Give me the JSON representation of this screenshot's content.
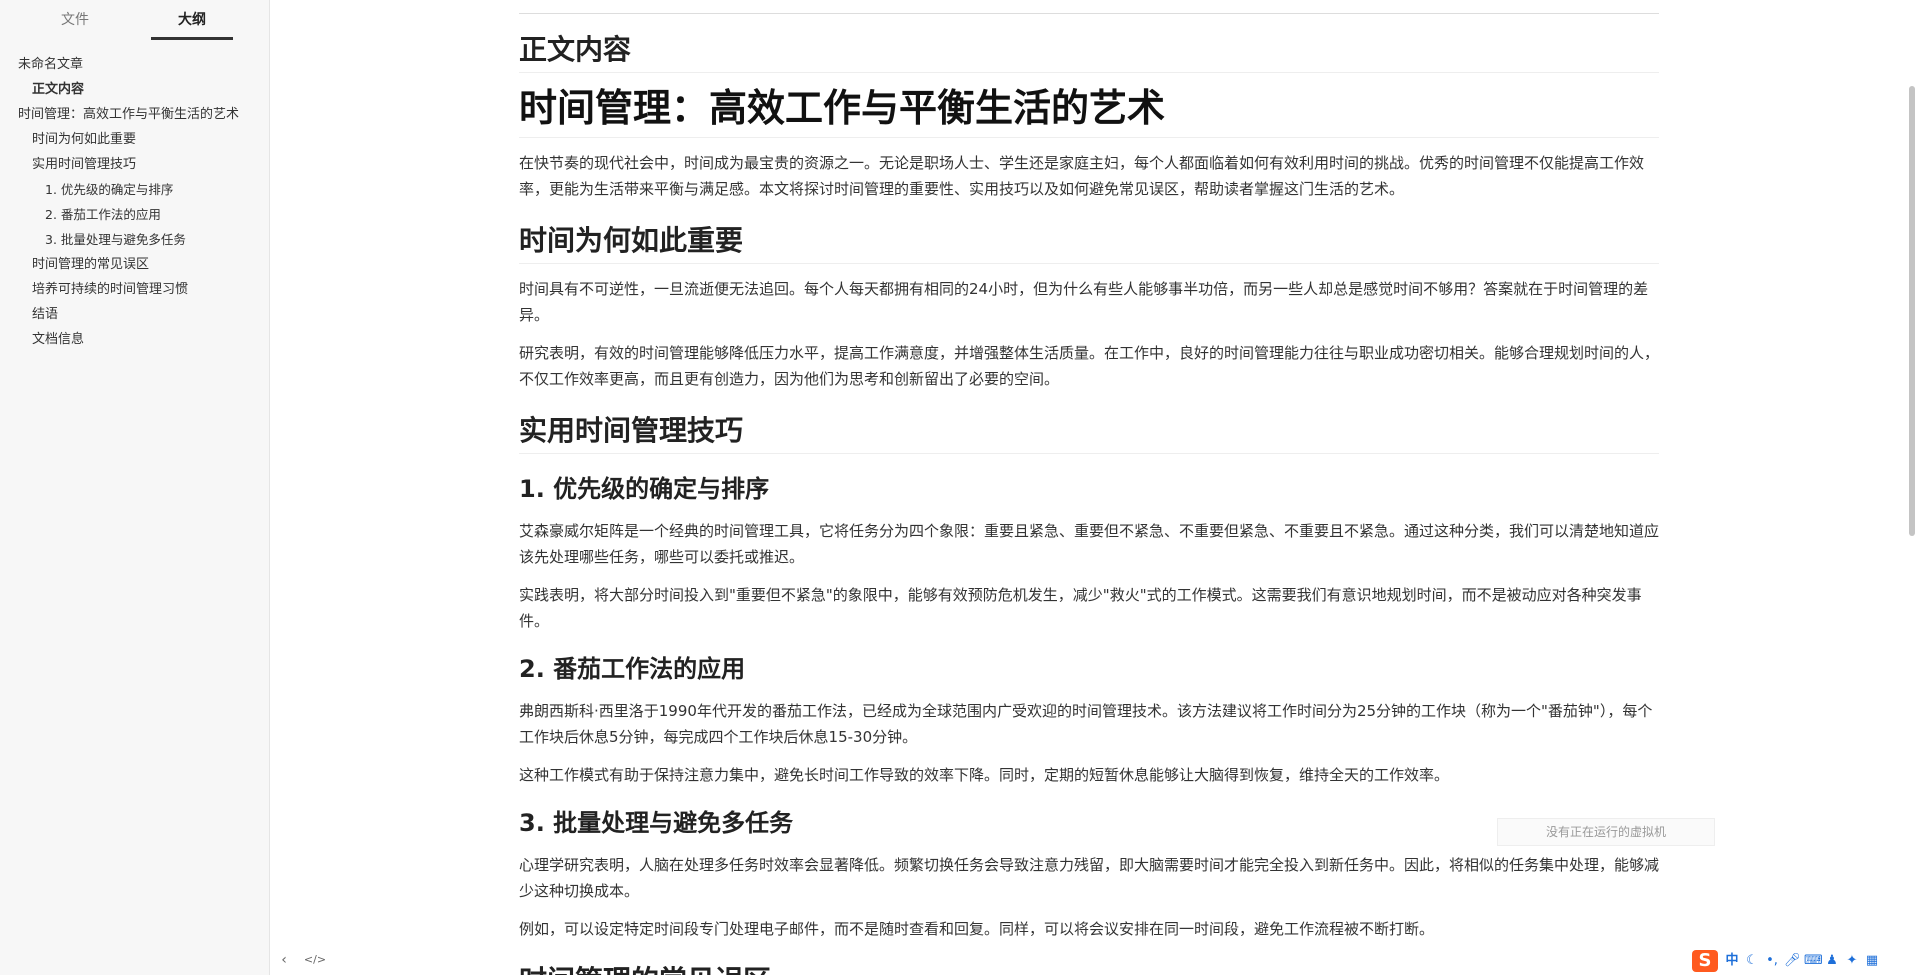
{
  "sidebar": {
    "tabs": [
      {
        "label": "文件"
      },
      {
        "label": "大纲"
      }
    ],
    "outline": [
      {
        "label": "未命名文章"
      },
      {
        "label": "正文内容"
      },
      {
        "label": "时间管理：高效工作与平衡生活的艺术"
      },
      {
        "label": "时间为何如此重要"
      },
      {
        "label": "实用时间管理技巧"
      },
      {
        "label": "1. 优先级的确定与排序"
      },
      {
        "label": "2. 番茄工作法的应用"
      },
      {
        "label": "3. 批量处理与避免多任务"
      },
      {
        "label": "时间管理的常见误区"
      },
      {
        "label": "培养可持续的时间管理习惯"
      },
      {
        "label": "结语"
      },
      {
        "label": "文档信息"
      }
    ],
    "footer": {
      "collapse_glyph": "‹",
      "source_glyph": "</>"
    }
  },
  "article": {
    "section_heading": "正文内容",
    "title": "时间管理：高效工作与平衡生活的艺术",
    "intro": "在快节奏的现代社会中，时间成为最宝贵的资源之一。无论是职场人士、学生还是家庭主妇，每个人都面临着如何有效利用时间的挑战。优秀的时间管理不仅能提高工作效率，更能为生活带来平衡与满足感。本文将探讨时间管理的重要性、实用技巧以及如何避免常见误区，帮助读者掌握这门生活的艺术。",
    "h2_why": "时间为何如此重要",
    "why_p1": "时间具有不可逆性，一旦流逝便无法追回。每个人每天都拥有相同的24小时，但为什么有些人能够事半功倍，而另一些人却总是感觉时间不够用？答案就在于时间管理的差异。",
    "why_p2": "研究表明，有效的时间管理能够降低压力水平，提高工作满意度，并增强整体生活质量。在工作中，良好的时间管理能力往往与职业成功密切相关。能够合理规划时间的人，不仅工作效率更高，而且更有创造力，因为他们为思考和创新留出了必要的空间。",
    "h2_tips": "实用时间管理技巧",
    "h3_priority": "1. 优先级的确定与排序",
    "priority_p1": "艾森豪威尔矩阵是一个经典的时间管理工具，它将任务分为四个象限：重要且紧急、重要但不紧急、不重要但紧急、不重要且不紧急。通过这种分类，我们可以清楚地知道应该先处理哪些任务，哪些可以委托或推迟。",
    "priority_p2": "实践表明，将大部分时间投入到\"重要但不紧急\"的象限中，能够有效预防危机发生，减少\"救火\"式的工作模式。这需要我们有意识地规划时间，而不是被动应对各种突发事件。",
    "h3_pomodoro": "2. 番茄工作法的应用",
    "pomodoro_p1": "弗朗西斯科·西里洛于1990年代开发的番茄工作法，已经成为全球范围内广受欢迎的时间管理技术。该方法建议将工作时间分为25分钟的工作块（称为一个\"番茄钟\"），每个工作块后休息5分钟，每完成四个工作块后休息15-30分钟。",
    "pomodoro_p2": "这种工作模式有助于保持注意力集中，避免长时间工作导致的效率下降。同时，定期的短暂休息能够让大脑得到恢复，维持全天的工作效率。",
    "h3_batch": "3. 批量处理与避免多任务",
    "batch_p1": "心理学研究表明，人脑在处理多任务时效率会显著降低。频繁切换任务会导致注意力残留，即大脑需要时间才能完全投入到新任务中。因此，将相似的任务集中处理，能够减少这种切换成本。",
    "batch_p2": "例如，可以设定特定时间段专门处理电子邮件，而不是随时查看和回复。同样，可以将会议安排在同一时间段，避免工作流程被不断打断。",
    "h2_pitfalls": "时间管理的常见误区"
  },
  "toast": {
    "text": "没有正在运行的虚拟机"
  },
  "ime": {
    "logo": "S",
    "mode": "中"
  }
}
